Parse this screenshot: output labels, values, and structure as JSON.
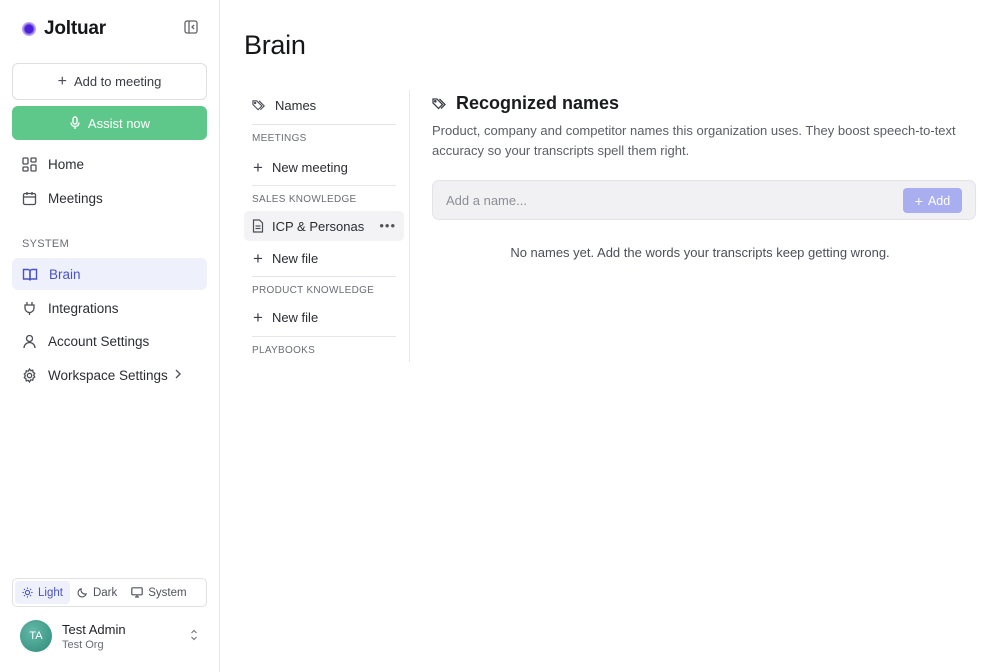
{
  "app": {
    "name": "Joltuar",
    "page_title": "Brain"
  },
  "sidebar": {
    "add_to_meeting": "Add to meeting",
    "assist_now": "Assist now",
    "nav": [
      {
        "label": "Home",
        "icon": "grid-icon"
      },
      {
        "label": "Meetings",
        "icon": "calendar-icon"
      }
    ],
    "system_label": "SYSTEM",
    "system_nav": [
      {
        "label": "Brain",
        "icon": "book-icon",
        "active": true
      },
      {
        "label": "Integrations",
        "icon": "plug-icon"
      },
      {
        "label": "Account Settings",
        "icon": "user-icon"
      },
      {
        "label": "Workspace Settings",
        "icon": "gear-icon"
      }
    ],
    "theme": {
      "options": [
        "Light",
        "Dark",
        "System"
      ],
      "selected": "Light"
    },
    "user": {
      "initials": "TA",
      "name": "Test Admin",
      "org": "Test Org"
    }
  },
  "brain_nav": {
    "names": "Names",
    "meetings_label": "MEETINGS",
    "new_meeting": "New meeting",
    "sales_label": "SALES KNOWLEDGE",
    "sales_file": "ICP & Personas",
    "sales_new_file": "New file",
    "product_label": "PRODUCT KNOWLEDGE",
    "product_new_file": "New file",
    "playbooks_label": "PLAYBOOKS"
  },
  "content": {
    "title": "Recognized names",
    "description": "Product, company and competitor names this organization uses. They boost speech-to-text accuracy so your transcripts spell them right.",
    "input_placeholder": "Add a name...",
    "add_label": "Add",
    "empty_message": "No names yet. Add the words your transcripts keep getting wrong."
  },
  "colors": {
    "accent": "#4a52c9",
    "primary_green": "#5ec88b",
    "add_button": "#a9aef0"
  }
}
